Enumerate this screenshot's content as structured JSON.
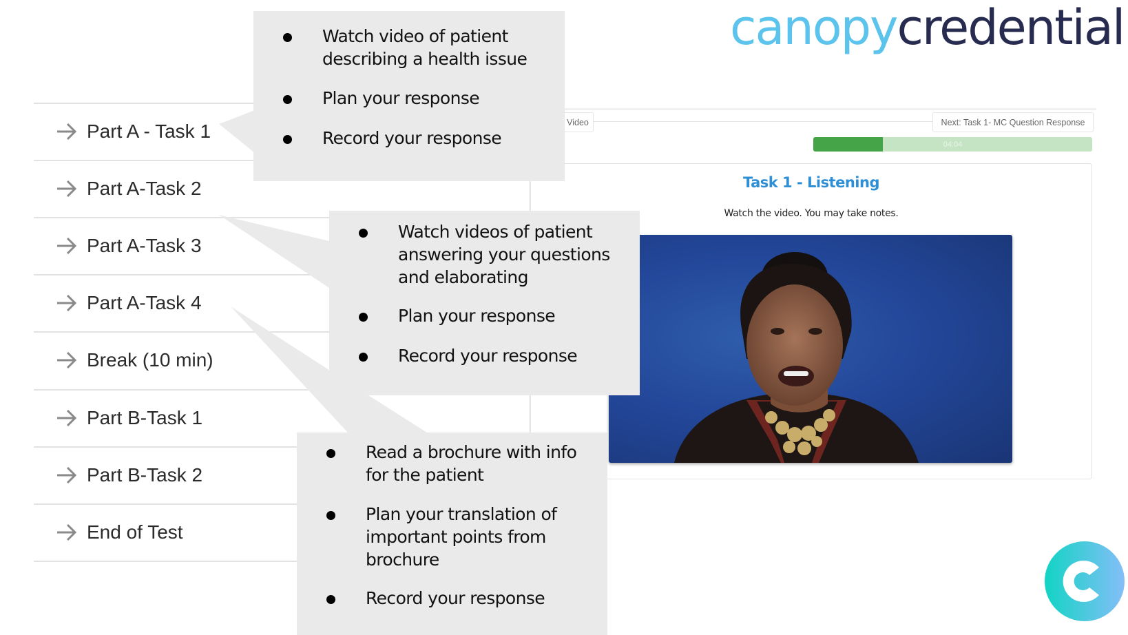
{
  "brand": {
    "part1": "canopy",
    "part2": "credential",
    "color1": "#5bc3ec",
    "color2": "#272b4f"
  },
  "sidebar": {
    "items": [
      {
        "label": "Part A - Task 1"
      },
      {
        "label": "Part A-Task 2"
      },
      {
        "label": "Part A-Task 3"
      },
      {
        "label": "Part A-Task 4"
      },
      {
        "label": "Break (10 min)"
      },
      {
        "label": "Part B-Task 1"
      },
      {
        "label": "Part B-Task 2"
      },
      {
        "label": "End of Test"
      }
    ]
  },
  "app": {
    "prev_button": "Video",
    "next_button": "Next: Task 1- MC Question Response",
    "timer": {
      "label": "04:04",
      "progress_percent": 25,
      "fill_color": "#44a447",
      "track_color": "#c4e4c4"
    },
    "task_title": "Task 1 - Listening",
    "task_instructions": "Watch the video. You may take notes.",
    "video": {
      "description": "Woman speaking in front of blue backdrop"
    }
  },
  "callouts": [
    {
      "items": [
        "Watch video of patient describing a health issue",
        "Plan your response",
        "Record your response"
      ]
    },
    {
      "items": [
        "Watch videos of patient answering your questions and elaborating",
        "Plan your response",
        "Record your response"
      ]
    },
    {
      "items": [
        "Read a brochure with info for the patient",
        "Plan your translation of important points from brochure",
        "Record your response"
      ]
    }
  ],
  "icons": {
    "sidebar_arrow": "arrow-right-icon",
    "logo": "canopy-c-logo-icon"
  }
}
